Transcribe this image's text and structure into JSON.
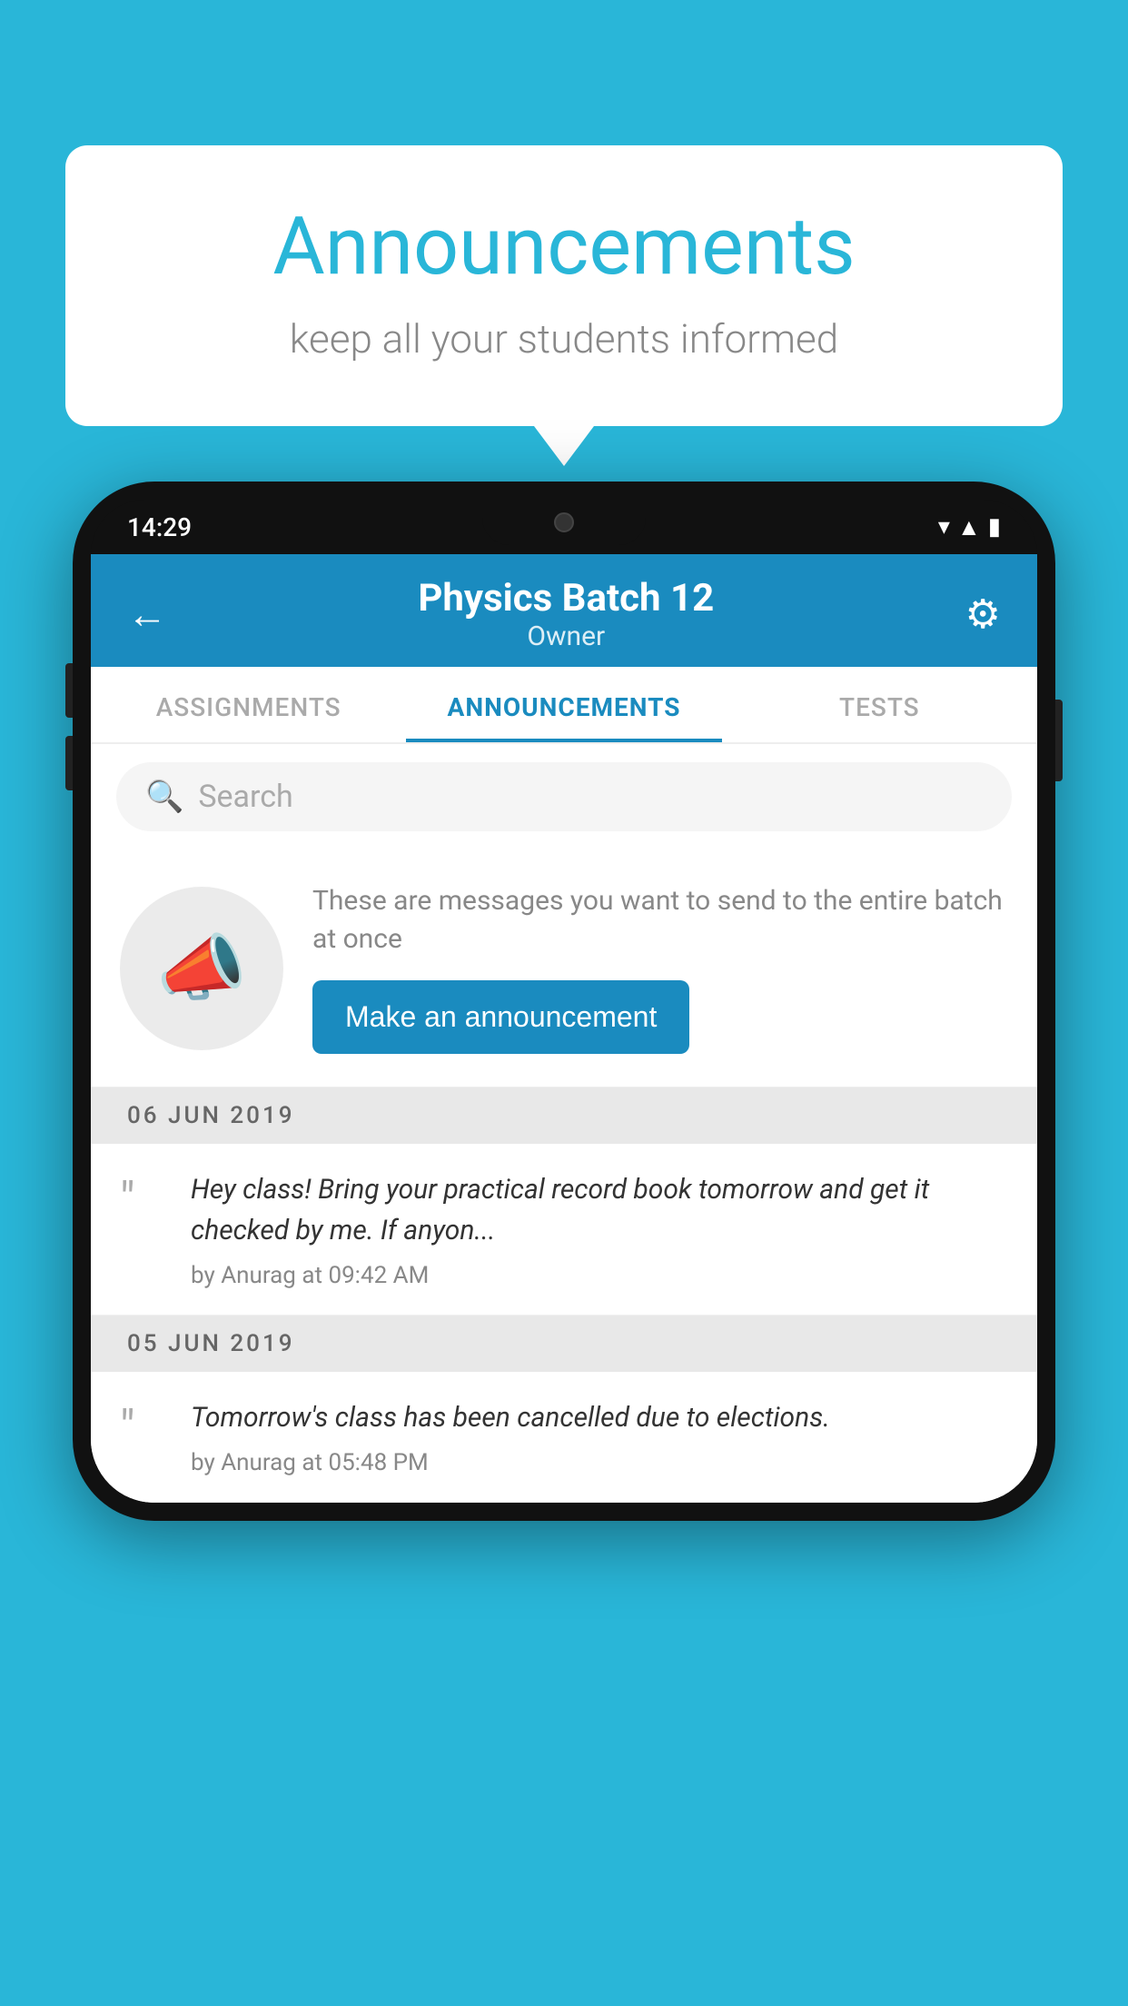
{
  "background_color": "#29b6d8",
  "speech_bubble": {
    "title": "Announcements",
    "subtitle": "keep all your students informed"
  },
  "phone": {
    "status_bar": {
      "time": "14:29"
    },
    "header": {
      "title": "Physics Batch 12",
      "subtitle": "Owner",
      "back_label": "←",
      "settings_label": "⚙"
    },
    "tabs": [
      {
        "label": "ASSIGNMENTS",
        "active": false
      },
      {
        "label": "ANNOUNCEMENTS",
        "active": true
      },
      {
        "label": "TESTS",
        "active": false
      }
    ],
    "search": {
      "placeholder": "Search"
    },
    "announcement_prompt": {
      "description": "These are messages you want to send to the entire batch at once",
      "button_label": "Make an announcement"
    },
    "announcements": [
      {
        "date": "06  JUN  2019",
        "text": "Hey class! Bring your practical record book tomorrow and get it checked by me. If anyon...",
        "meta": "by Anurag at 09:42 AM"
      },
      {
        "date": "05  JUN  2019",
        "text": "Tomorrow's class has been cancelled due to elections.",
        "meta": "by Anurag at 05:48 PM"
      }
    ]
  }
}
